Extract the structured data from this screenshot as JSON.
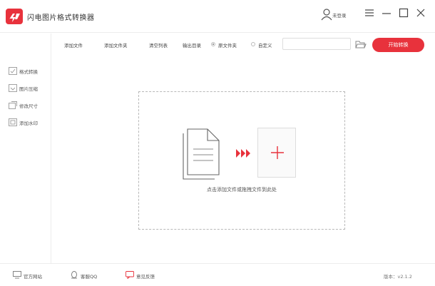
{
  "app": {
    "title": "闪电图片格式转换器",
    "user_label": "未登录"
  },
  "colors": {
    "accent": "#e8323c",
    "border": "#b8b8b8",
    "text": "#333333"
  },
  "toolbar": {
    "add_file": "添加文件",
    "add_folder": "添加文件夹",
    "clear_list": "清空列表",
    "output_label": "输出目录",
    "option_original": "原文件夹",
    "option_custom": "自定义",
    "start_button": "开始转换",
    "path_value": ""
  },
  "sidebar": {
    "items": [
      {
        "label": "格式转换",
        "icon": "convert-icon"
      },
      {
        "label": "图片压缩",
        "icon": "compress-icon"
      },
      {
        "label": "修改尺寸",
        "icon": "resize-icon"
      },
      {
        "label": "添加水印",
        "icon": "watermark-icon"
      }
    ]
  },
  "dropzone": {
    "hint": "点击添加文件或拖拽文件到此处"
  },
  "statusbar": {
    "website": "官方网站",
    "support": "客服QQ",
    "feedback": "意见反馈",
    "version": "版本：v2.1.2"
  }
}
